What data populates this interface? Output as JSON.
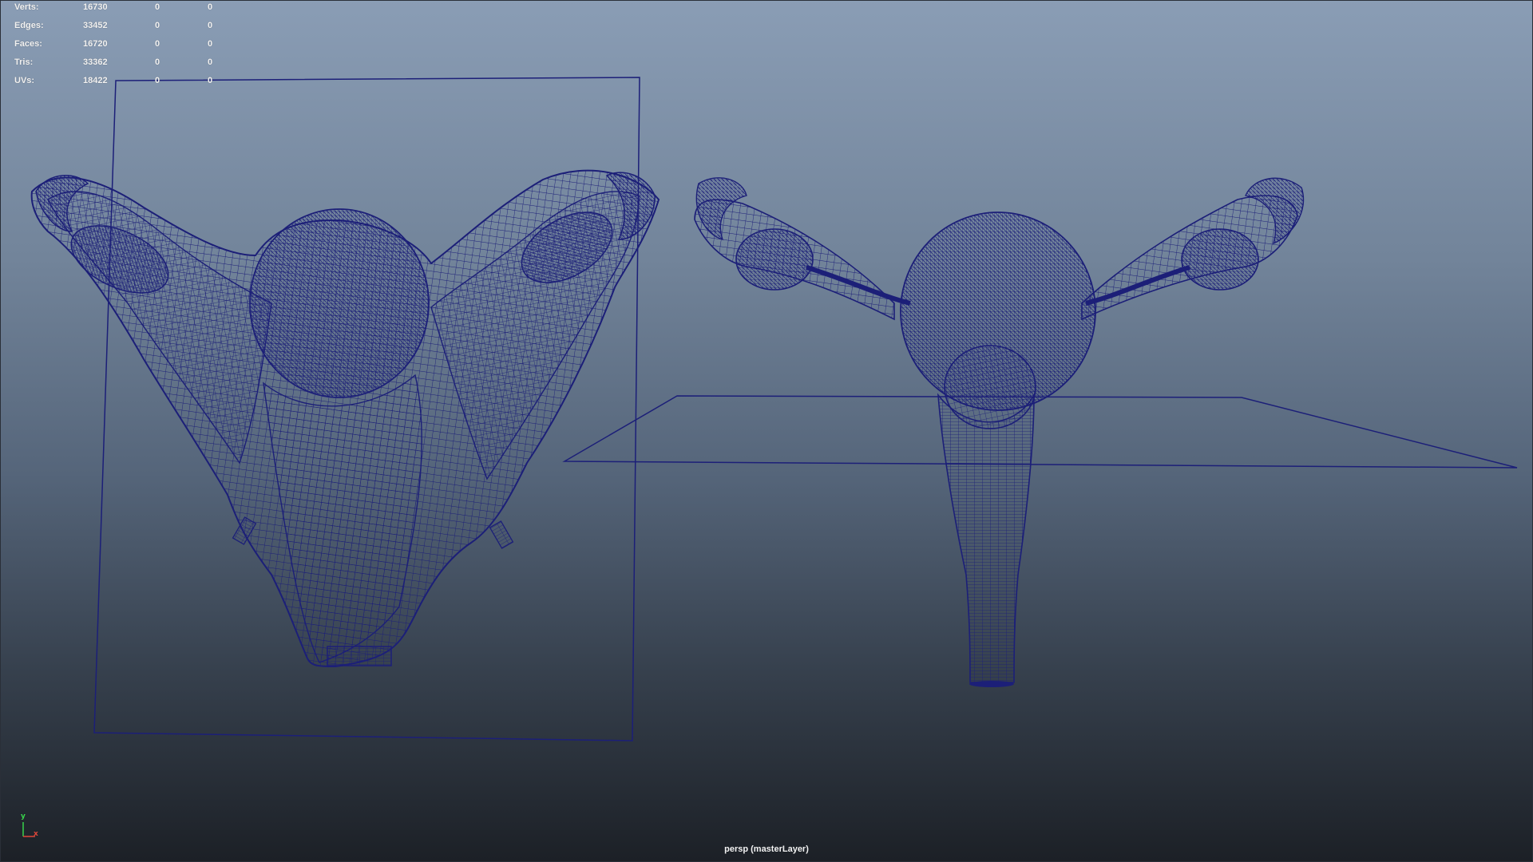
{
  "hud": {
    "rows": [
      {
        "label": "Verts:",
        "total": "16730",
        "c2": "0",
        "c3": "0"
      },
      {
        "label": "Edges:",
        "total": "33452",
        "c2": "0",
        "c3": "0"
      },
      {
        "label": "Faces:",
        "total": "16720",
        "c2": "0",
        "c3": "0"
      },
      {
        "label": "Tris:",
        "total": "33362",
        "c2": "0",
        "c3": "0"
      },
      {
        "label": "UVs:",
        "total": "18422",
        "c2": "0",
        "c3": "0"
      }
    ]
  },
  "camera_label": "persp (masterLayer)",
  "axis": {
    "y": "y",
    "x": "x"
  },
  "colors": {
    "wire": "#1c1f78",
    "axis_x": "#e0473a",
    "axis_y": "#39d24b"
  },
  "scene": {
    "objects": [
      "uterus-model-front",
      "uterus-model-side",
      "image-plane-vertical",
      "image-plane-horizontal"
    ]
  }
}
